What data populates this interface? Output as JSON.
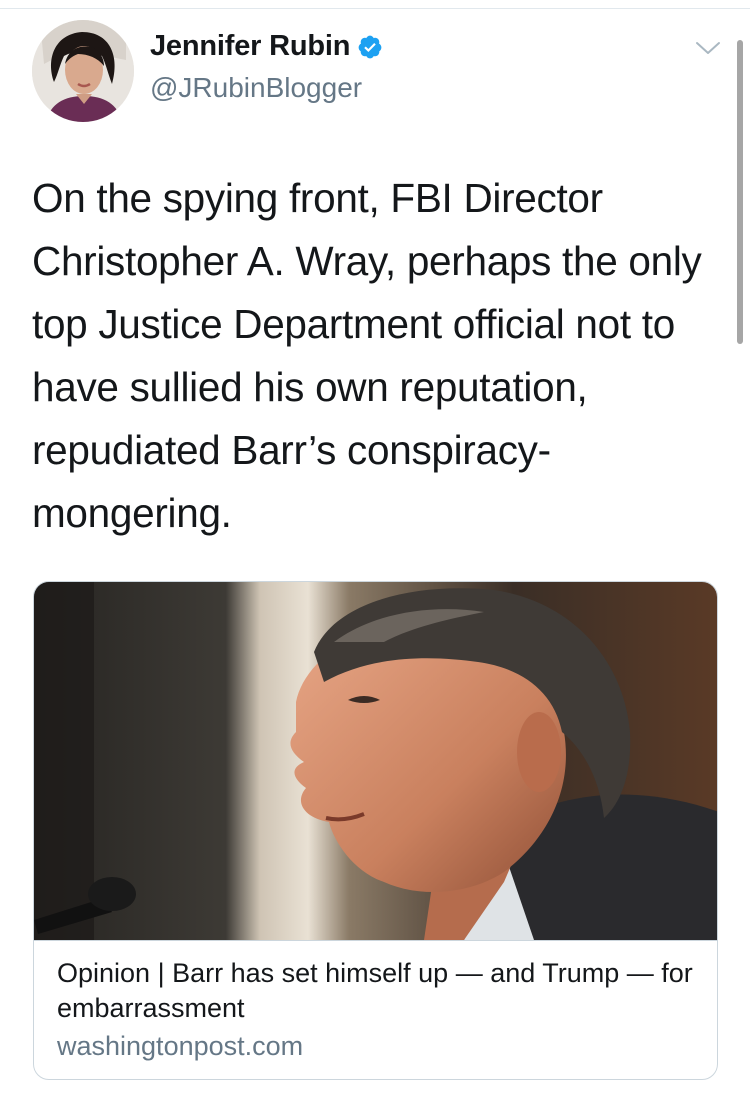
{
  "author": {
    "display_name": "Jennifer Rubin",
    "handle": "@JRubinBlogger",
    "verified": true
  },
  "tweet": {
    "text": "On the spying front, FBI Director Christopher A. Wray, perhaps the only top Justice Department official not to have sullied his own reputation, repudiated Barr’s conspiracy-mongering."
  },
  "link_card": {
    "title": "Opinion | Barr has set himself up — and Trump — for embarrassment",
    "domain": "washingtonpost.com"
  },
  "icons": {
    "verified": "verified-badge-icon",
    "menu": "chevron-down-icon"
  },
  "colors": {
    "text": "#14171a",
    "secondary": "#657786",
    "verified_blue": "#1da1f2",
    "border": "#ccd6dd"
  }
}
